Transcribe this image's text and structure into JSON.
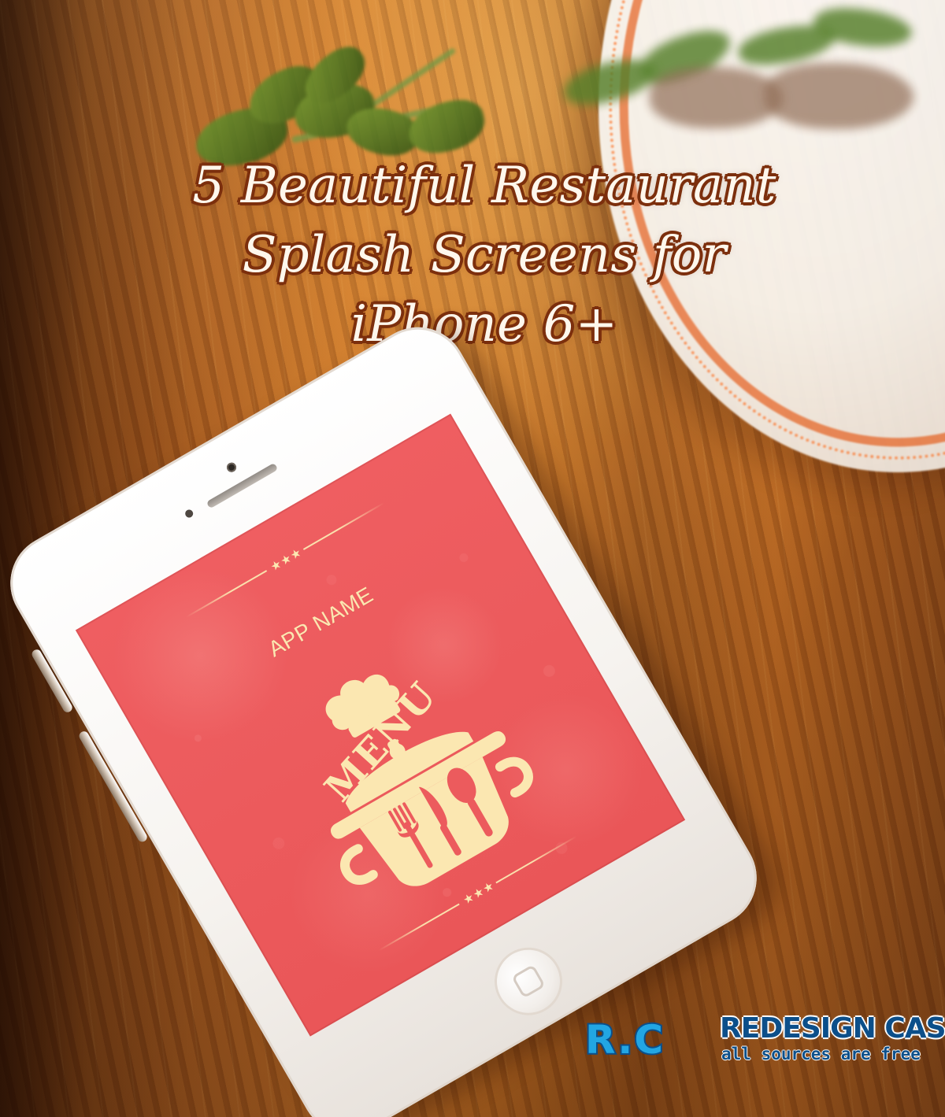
{
  "hero": {
    "title_lines": [
      "5 Beautiful Restaurant",
      "Splash Screens for",
      "iPhone 6+"
    ]
  },
  "phone_screen": {
    "app_name": "APP NAME",
    "menu_label": "MENU",
    "stars": "★★★",
    "colors": {
      "screen_red": "#ec5b5d",
      "cream": "#fbe7b1"
    }
  },
  "brand": {
    "mark": "R.C",
    "title": "REDESIGN CASE",
    "tagline": "all sources are free",
    "colors": {
      "blue": "#0c4f8a",
      "light_blue": "#22a6e3"
    }
  },
  "icons": {
    "pot": "cooking-pot-icon",
    "chef_hat": "chef-hat-icon",
    "fork": "fork-icon",
    "knife": "knife-icon",
    "spoon": "spoon-icon"
  }
}
